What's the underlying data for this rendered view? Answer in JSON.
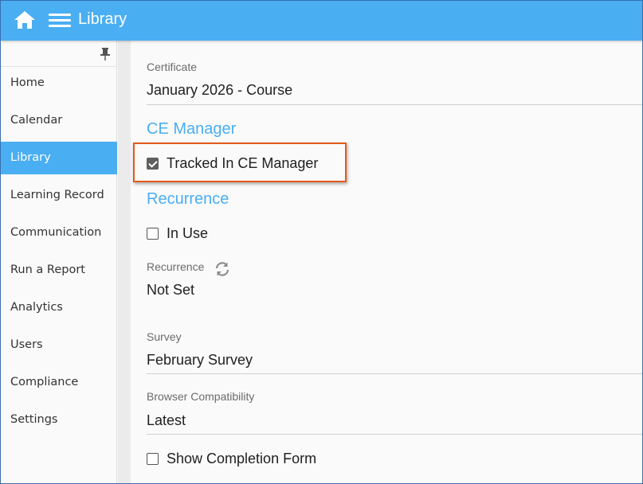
{
  "header": {
    "home_icon": "home-icon",
    "menu_icon": "hamburger-menu-icon",
    "title": "Library",
    "bg_color": "#4aaef2"
  },
  "sidebar": {
    "pin_icon": "pin-icon",
    "items": [
      {
        "label": "Home",
        "active": false
      },
      {
        "label": "Calendar",
        "active": false
      },
      {
        "label": "Library",
        "active": true
      },
      {
        "label": "Learning Record",
        "active": false
      },
      {
        "label": "Communication",
        "active": false
      },
      {
        "label": "Run a Report",
        "active": false
      },
      {
        "label": "Analytics",
        "active": false
      },
      {
        "label": "Users",
        "active": false
      },
      {
        "label": "Compliance",
        "active": false
      },
      {
        "label": "Settings",
        "active": false
      }
    ]
  },
  "main": {
    "certificate": {
      "label": "Certificate",
      "value": "January 2026 - Course"
    },
    "ce_manager": {
      "section_title": "CE Manager",
      "tracked_checkbox": {
        "label": "Tracked In CE Manager",
        "checked": true
      }
    },
    "recurrence_section": {
      "section_title": "Recurrence",
      "in_use_checkbox": {
        "label": "In Use",
        "checked": false
      },
      "recurrence_label": "Recurrence",
      "recurrence_icon": "refresh-icon",
      "recurrence_value": "Not Set"
    },
    "survey": {
      "label": "Survey",
      "value": "February Survey"
    },
    "browser_compatibility": {
      "label": "Browser Compatibility",
      "value": "Latest"
    },
    "show_completion_checkbox": {
      "label": "Show Completion Form",
      "checked": false
    }
  },
  "colors": {
    "accent": "#4aaef2",
    "highlight": "#e35b1a"
  }
}
